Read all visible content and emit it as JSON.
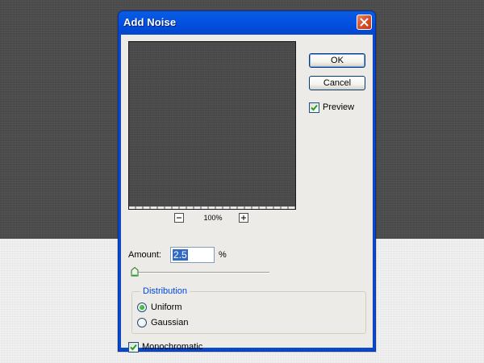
{
  "dialog": {
    "title": "Add Noise",
    "close_icon": "close-icon"
  },
  "preview": {
    "zoom_level": "100%",
    "zoom_out_icon": "minus-icon",
    "zoom_in_icon": "plus-icon"
  },
  "buttons": {
    "ok_label": "OK",
    "cancel_label": "Cancel"
  },
  "preview_option": {
    "label": "Preview",
    "checked": true
  },
  "amount": {
    "label": "Amount:",
    "value": "2.5",
    "unit": "%",
    "slider_fraction": 0.0
  },
  "distribution": {
    "legend": "Distribution",
    "options": [
      {
        "label": "Uniform",
        "selected": true
      },
      {
        "label": "Gaussian",
        "selected": false
      }
    ]
  },
  "monochromatic": {
    "label": "Monochromatic",
    "checked": true
  },
  "colors": {
    "titlebar": "#0554e3",
    "close_button": "#d8532d",
    "group_legend": "#0046d5",
    "selection": "#316ac5",
    "check_mark": "#21a121"
  }
}
